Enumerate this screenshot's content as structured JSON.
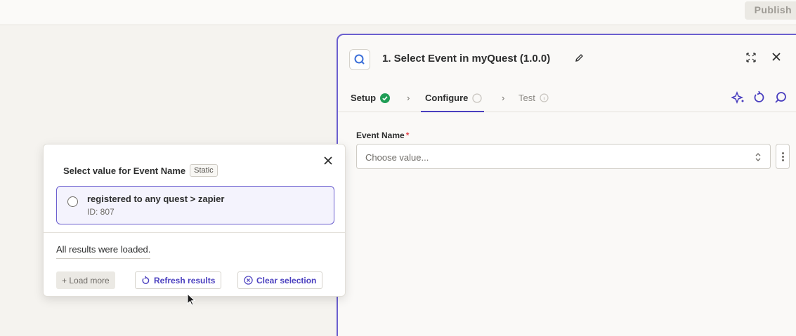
{
  "topbar": {
    "publish_label": "Publish"
  },
  "panel": {
    "title": "1. Select Event in myQuest (1.0.0)",
    "tabs": [
      {
        "label": "Setup",
        "state": "complete"
      },
      {
        "label": "Configure",
        "state": "active"
      },
      {
        "label": "Test",
        "state": "disabled"
      }
    ],
    "field": {
      "label": "Event Name",
      "required_mark": "*",
      "placeholder": "Choose value..."
    }
  },
  "popup": {
    "title": "Select value for Event Name",
    "badge": "Static",
    "options": [
      {
        "label": "registered to any quest > zapier",
        "id": "ID: 807"
      }
    ],
    "status": "All results were loaded.",
    "buttons": {
      "load_more": "+ Load more",
      "refresh": "Refresh results",
      "clear": "Clear selection"
    }
  },
  "colors": {
    "accent": "#4a3fbf",
    "panel_border": "#6b5fcf",
    "success": "#1f9d55",
    "required": "#e5484d",
    "background": "#f5f3ef"
  },
  "icons": [
    "app-logo-icon",
    "pencil-icon",
    "expand-icon",
    "close-icon",
    "check-circle-icon",
    "chevron-right-icon",
    "sparkle-icon",
    "refresh-icon",
    "search-icon",
    "updown-icon",
    "kebab-icon",
    "refresh-small-icon",
    "clear-circle-icon",
    "cursor-icon"
  ]
}
